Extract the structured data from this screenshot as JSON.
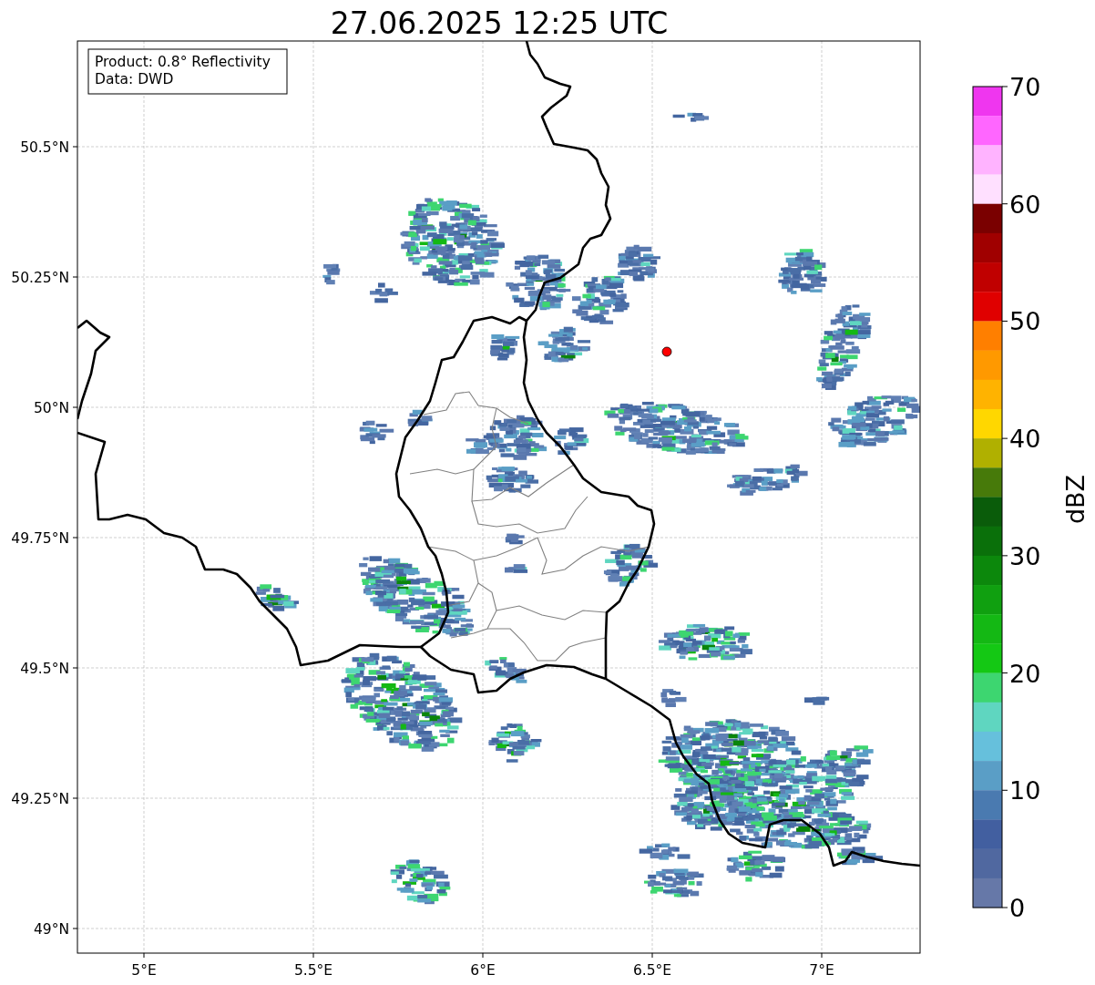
{
  "title": "27.06.2025 12:25 UTC",
  "map": {
    "info_box": [
      "Product: 0.8° Reflectivity",
      "Data: DWD"
    ],
    "lat_labels": [
      "50.5°N",
      "50.25°N",
      "50°N",
      "49.75°N",
      "49.5°N",
      "49.25°N",
      "49°N"
    ],
    "lon_labels": [
      "5°E",
      "5.5°E",
      "6°E",
      "6.5°E",
      "7°E"
    ]
  },
  "colorbar": {
    "label": "dBZ",
    "ticks": [
      "70",
      "60",
      "50",
      "40",
      "30",
      "20",
      "10",
      "0"
    ],
    "segments": [
      {
        "color": "#ef36ef"
      },
      {
        "color": "#ff66ff"
      },
      {
        "color": "#ffb3ff"
      },
      {
        "color": "#ffe0ff"
      },
      {
        "color": "#7a0000"
      },
      {
        "color": "#a00000"
      },
      {
        "color": "#c00000"
      },
      {
        "color": "#e00000"
      },
      {
        "color": "#ff7f00"
      },
      {
        "color": "#ff9900"
      },
      {
        "color": "#ffb300"
      },
      {
        "color": "#ffd700"
      },
      {
        "color": "#b0b000"
      },
      {
        "color": "#477a0a"
      },
      {
        "color": "#0a5c0a"
      },
      {
        "color": "#0a700a"
      },
      {
        "color": "#0c880c"
      },
      {
        "color": "#10a010"
      },
      {
        "color": "#14b814"
      },
      {
        "color": "#14c814"
      },
      {
        "color": "#3dd670"
      },
      {
        "color": "#5fd6c0"
      },
      {
        "color": "#66c0dc"
      },
      {
        "color": "#5a9ec6"
      },
      {
        "color": "#4a7ab0"
      },
      {
        "color": "#425fa0"
      },
      {
        "color": "#5068a0"
      },
      {
        "color": "#6678a8"
      }
    ]
  }
}
